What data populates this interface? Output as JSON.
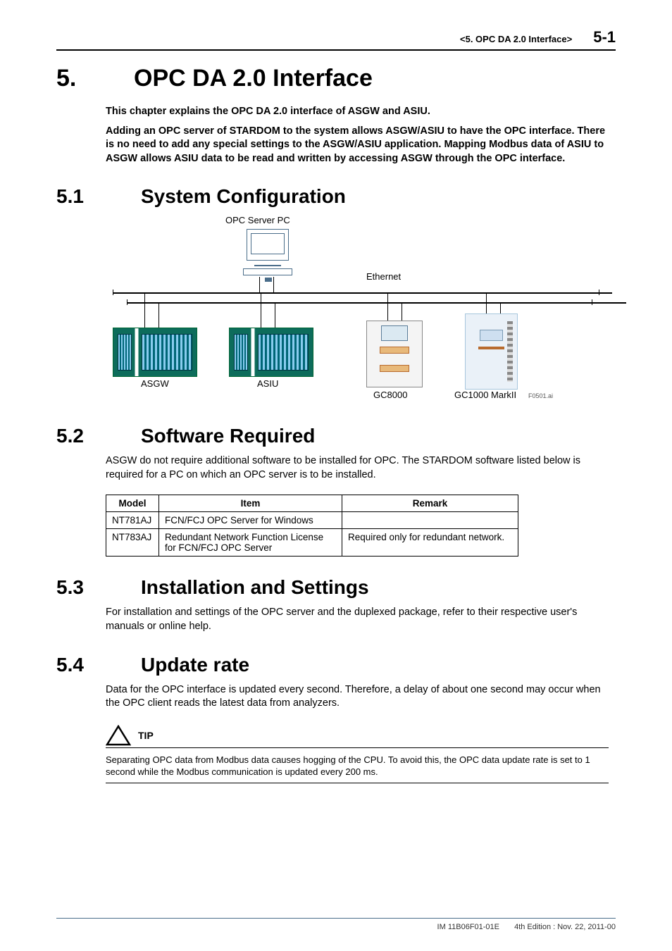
{
  "header": {
    "chapter_ref": "<5.  OPC DA 2.0 Interface>",
    "page_num": "5-1"
  },
  "h1": {
    "num": "5.",
    "title": "OPC DA 2.0 Interface"
  },
  "intro": {
    "p1": "This chapter explains the OPC DA 2.0 interface of ASGW and ASIU.",
    "p2": "Adding an OPC server of STARDOM to the system allows ASGW/ASIU to have the OPC interface. There is no need to add any special settings to the ASGW/ASIU application. Mapping Modbus data of ASIU to ASGW allows ASIU data to be read and written by accessing ASGW through the OPC interface."
  },
  "sec51": {
    "num": "5.1",
    "title": "System Configuration",
    "figure": {
      "opc_server_pc": "OPC Server PC",
      "ethernet": "Ethernet",
      "asgw": "ASGW",
      "asiu": "ASIU",
      "gc8000": "GC8000",
      "gc1000": "GC1000 MarkII",
      "figure_id": "F0501.ai"
    }
  },
  "sec52": {
    "num": "5.2",
    "title": "Software Required",
    "para": "ASGW do not require additional software to be installed for OPC. The STARDOM software listed below is required for a PC on which an OPC server is to be installed.",
    "table": {
      "headers": {
        "model": "Model",
        "item": "Item",
        "remark": "Remark"
      },
      "rows": [
        {
          "model": "NT781AJ",
          "item": "FCN/FCJ OPC Server for Windows",
          "remark": ""
        },
        {
          "model": "NT783AJ",
          "item": "Redundant Network Function License for FCN/FCJ OPC Server",
          "remark": "Required only for redundant network."
        }
      ]
    }
  },
  "sec53": {
    "num": "5.3",
    "title": "Installation and Settings",
    "para": "For installation and settings of the OPC server and the duplexed package, refer to their respective user's manuals or online help."
  },
  "sec54": {
    "num": "5.4",
    "title": "Update rate",
    "para": "Data for the OPC interface is updated every second. Therefore, a delay of about one second may occur when the OPC client reads the latest data from analyzers.",
    "tip": {
      "label": "TIP",
      "body": "Separating OPC data from Modbus data causes hogging of the CPU. To avoid this, the OPC data update rate is set to 1 second while the Modbus communication is updated every 200 ms."
    }
  },
  "footer": {
    "doc_id": "IM 11B06F01-01E",
    "edition": "4th Edition : Nov. 22, 2011-00"
  }
}
